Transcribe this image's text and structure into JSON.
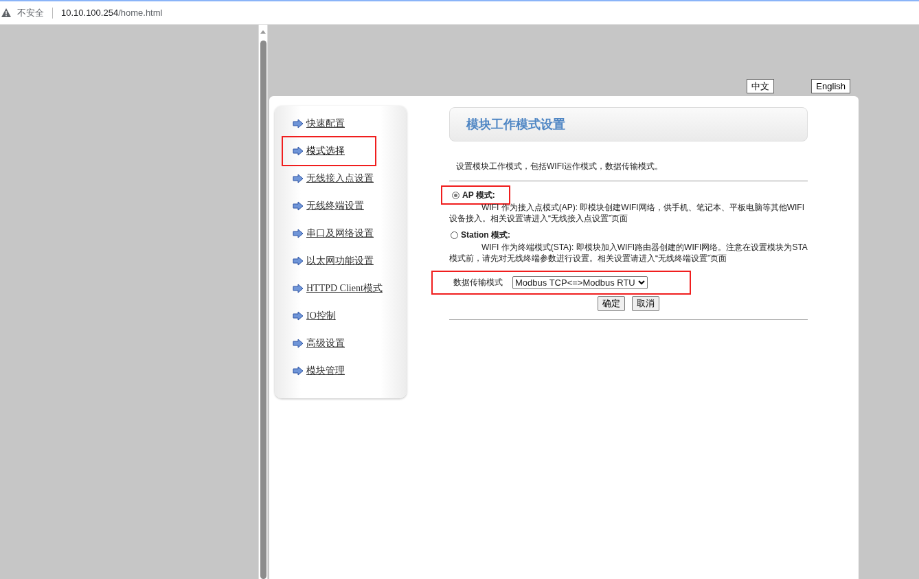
{
  "address_bar": {
    "security": "不安全",
    "host": "10.10.100.254",
    "path": "/home.html"
  },
  "language_buttons": [
    "中文",
    "English"
  ],
  "sidebar": {
    "items": [
      {
        "label": "快速配置",
        "selected": false,
        "highlighted": false
      },
      {
        "label": "模式选择",
        "selected": true,
        "highlighted": true
      },
      {
        "label": "无线接入点设置",
        "selected": false,
        "highlighted": false
      },
      {
        "label": "无线终端设置",
        "selected": false,
        "highlighted": false
      },
      {
        "label": "串口及网络设置",
        "selected": false,
        "highlighted": false
      },
      {
        "label": "以太网功能设置",
        "selected": false,
        "highlighted": false
      },
      {
        "label": "HTTPD Client模式",
        "selected": false,
        "highlighted": false
      },
      {
        "label": "IO控制",
        "selected": false,
        "highlighted": false
      },
      {
        "label": "高级设置",
        "selected": false,
        "highlighted": false
      },
      {
        "label": "模块管理",
        "selected": false,
        "highlighted": false
      }
    ]
  },
  "panel": {
    "title": "模块工作模式设置",
    "intro": "设置模块工作模式，包括WIFI运作模式，数据传输模式。",
    "modes": [
      {
        "label": "AP 模式:",
        "selected": true,
        "highlighted": true,
        "description": "WIFI 作为接入点模式(AP): 即模块创建WIFI网络，供手机、笔记本、平板电脑等其他WIFI设备接入。相关设置请进入“无线接入点设置”页面"
      },
      {
        "label": "Station 模式:",
        "selected": false,
        "highlighted": false,
        "description": "WIFI 作为终端模式(STA): 即模块加入WIFI路由器创建的WIFI网络。注意在设置模块为STA模式前，请先对无线终端参数进行设置。相关设置请进入“无线终端设置”页面"
      }
    ],
    "transfer": {
      "label": "数据传输模式",
      "value": "Modbus TCP<=>Modbus RTU",
      "highlighted": true
    },
    "buttons": [
      "确定",
      "取消"
    ]
  }
}
